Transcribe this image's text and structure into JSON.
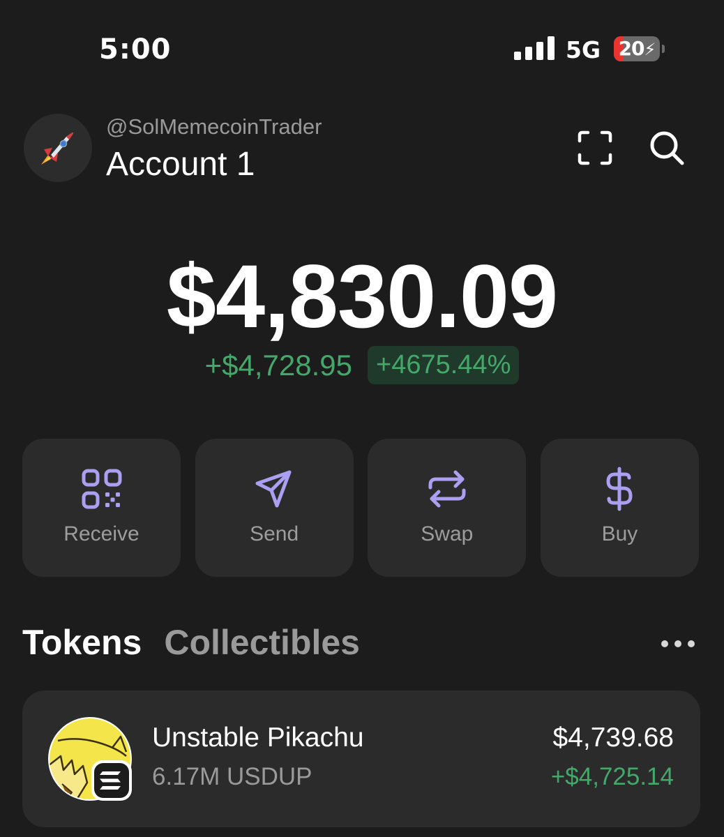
{
  "status_bar": {
    "time": "5:00",
    "network": "5G",
    "battery_level": "20",
    "battery_fraction": 0.2
  },
  "header": {
    "handle": "@SolMemecoinTrader",
    "account_name": "Account 1",
    "avatar_icon": "rocket-icon",
    "scan_icon": "scan-frame-icon",
    "search_icon": "search-icon"
  },
  "balance": {
    "total": "$4,830.09",
    "change_amount": "+$4,728.95",
    "change_percent": "+4675.44%"
  },
  "actions": [
    {
      "label": "Receive",
      "icon": "qr-code-icon"
    },
    {
      "label": "Send",
      "icon": "send-icon"
    },
    {
      "label": "Swap",
      "icon": "swap-icon"
    },
    {
      "label": "Buy",
      "icon": "dollar-icon"
    }
  ],
  "tabs": {
    "active": "Tokens",
    "inactive": "Collectibles",
    "more_icon": "more-horizontal-icon"
  },
  "tokens": [
    {
      "name": "Unstable Pikachu",
      "amount": "6.17M USDUP",
      "value": "$4,739.68",
      "change": "+$4,725.14",
      "chain_icon": "solana-icon"
    }
  ],
  "colors": {
    "background": "#1c1c1c",
    "card": "#2b2b2b",
    "accent": "#ab9ff2",
    "positive": "#45a86b",
    "muted": "#9a9a9a"
  }
}
